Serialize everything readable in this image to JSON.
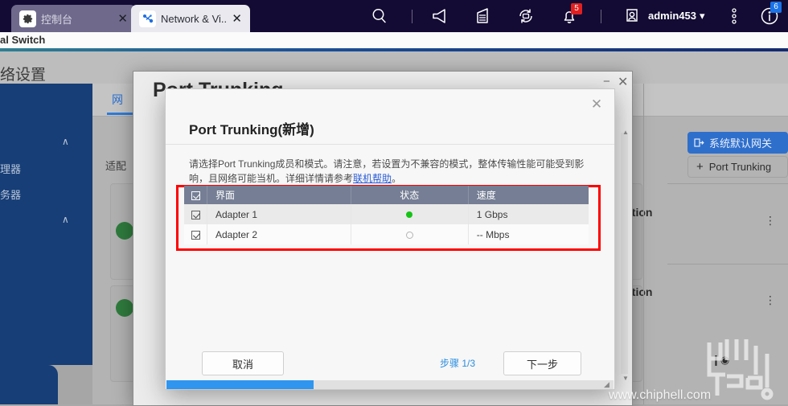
{
  "browser": {
    "tabs": [
      {
        "label": "控制台",
        "favicon": "gear-icon",
        "close": "✕"
      },
      {
        "label": "Network & Vi...",
        "favicon": "network-icon",
        "close": "✕"
      }
    ],
    "toolbar": {
      "search": "search-icon",
      "announce": "megaphone-icon",
      "logs": "list-icon",
      "sync": "sync-icon",
      "notifications": "bell-icon",
      "notifications_badge": "5",
      "user_avatar": "user-icon",
      "user_name": "admin453",
      "user_caret": "▾",
      "more": "kebab-menu-icon",
      "info": "info-icon",
      "info_badge": "6"
    },
    "accent_color": "#1c4f96",
    "chrome_color": "#140b34"
  },
  "page": {
    "breadcrumb_fragment": "al Switch"
  },
  "app": {
    "header_title": "络设置",
    "sidebar": {
      "chevron": "∧",
      "items": [
        {
          "label": "理器"
        },
        {
          "label": "务器"
        }
      ]
    },
    "tab_active": "网",
    "section_label": "适配",
    "buttons": {
      "gateway": "系统默认网关",
      "gateway_icon": "gateway-icon",
      "port_trunking": "Port Trunking",
      "port_trunking_icon": "plus-icon"
    },
    "cards": [
      {
        "status_color": "#2f7a3d",
        "text_fragment": "ction",
        "menu": "kebab-menu-icon"
      },
      {
        "status_color": "#2f7a3d",
        "text_fragment": "ction",
        "menu": "kebab-menu-icon"
      }
    ]
  },
  "parent_window": {
    "title": "Port Trunking",
    "minimize": "−",
    "close": "✕",
    "tab_label": "网"
  },
  "dialog": {
    "title": "Port Trunking(新增)",
    "close": "✕",
    "description_before": "请选择Port Trunking成员和模式。请注意，若设置为不兼容的模式，整体传输性能可能受到影响，且网络可能当机。详细详情请参考",
    "description_link": "联机帮助",
    "description_after": "。",
    "table": {
      "headers": [
        "",
        "界面",
        "状态",
        "速度"
      ],
      "header_checkbox_checked": true,
      "rows": [
        {
          "checked": true,
          "interface": "Adapter 1",
          "status": "on",
          "speed": "1 Gbps"
        },
        {
          "checked": true,
          "interface": "Adapter 2",
          "status": "off",
          "speed": "-- Mbps"
        }
      ]
    },
    "footer": {
      "cancel": "取消",
      "step": "步骤 1/3",
      "next": "下一步"
    },
    "highlight_color": "#ff0000",
    "scroll_thumb_color": "#2f95ef",
    "resize_grip": "◢"
  },
  "watermark": {
    "url": "www.chiphell.com",
    "logo": "chiphell-logo"
  }
}
